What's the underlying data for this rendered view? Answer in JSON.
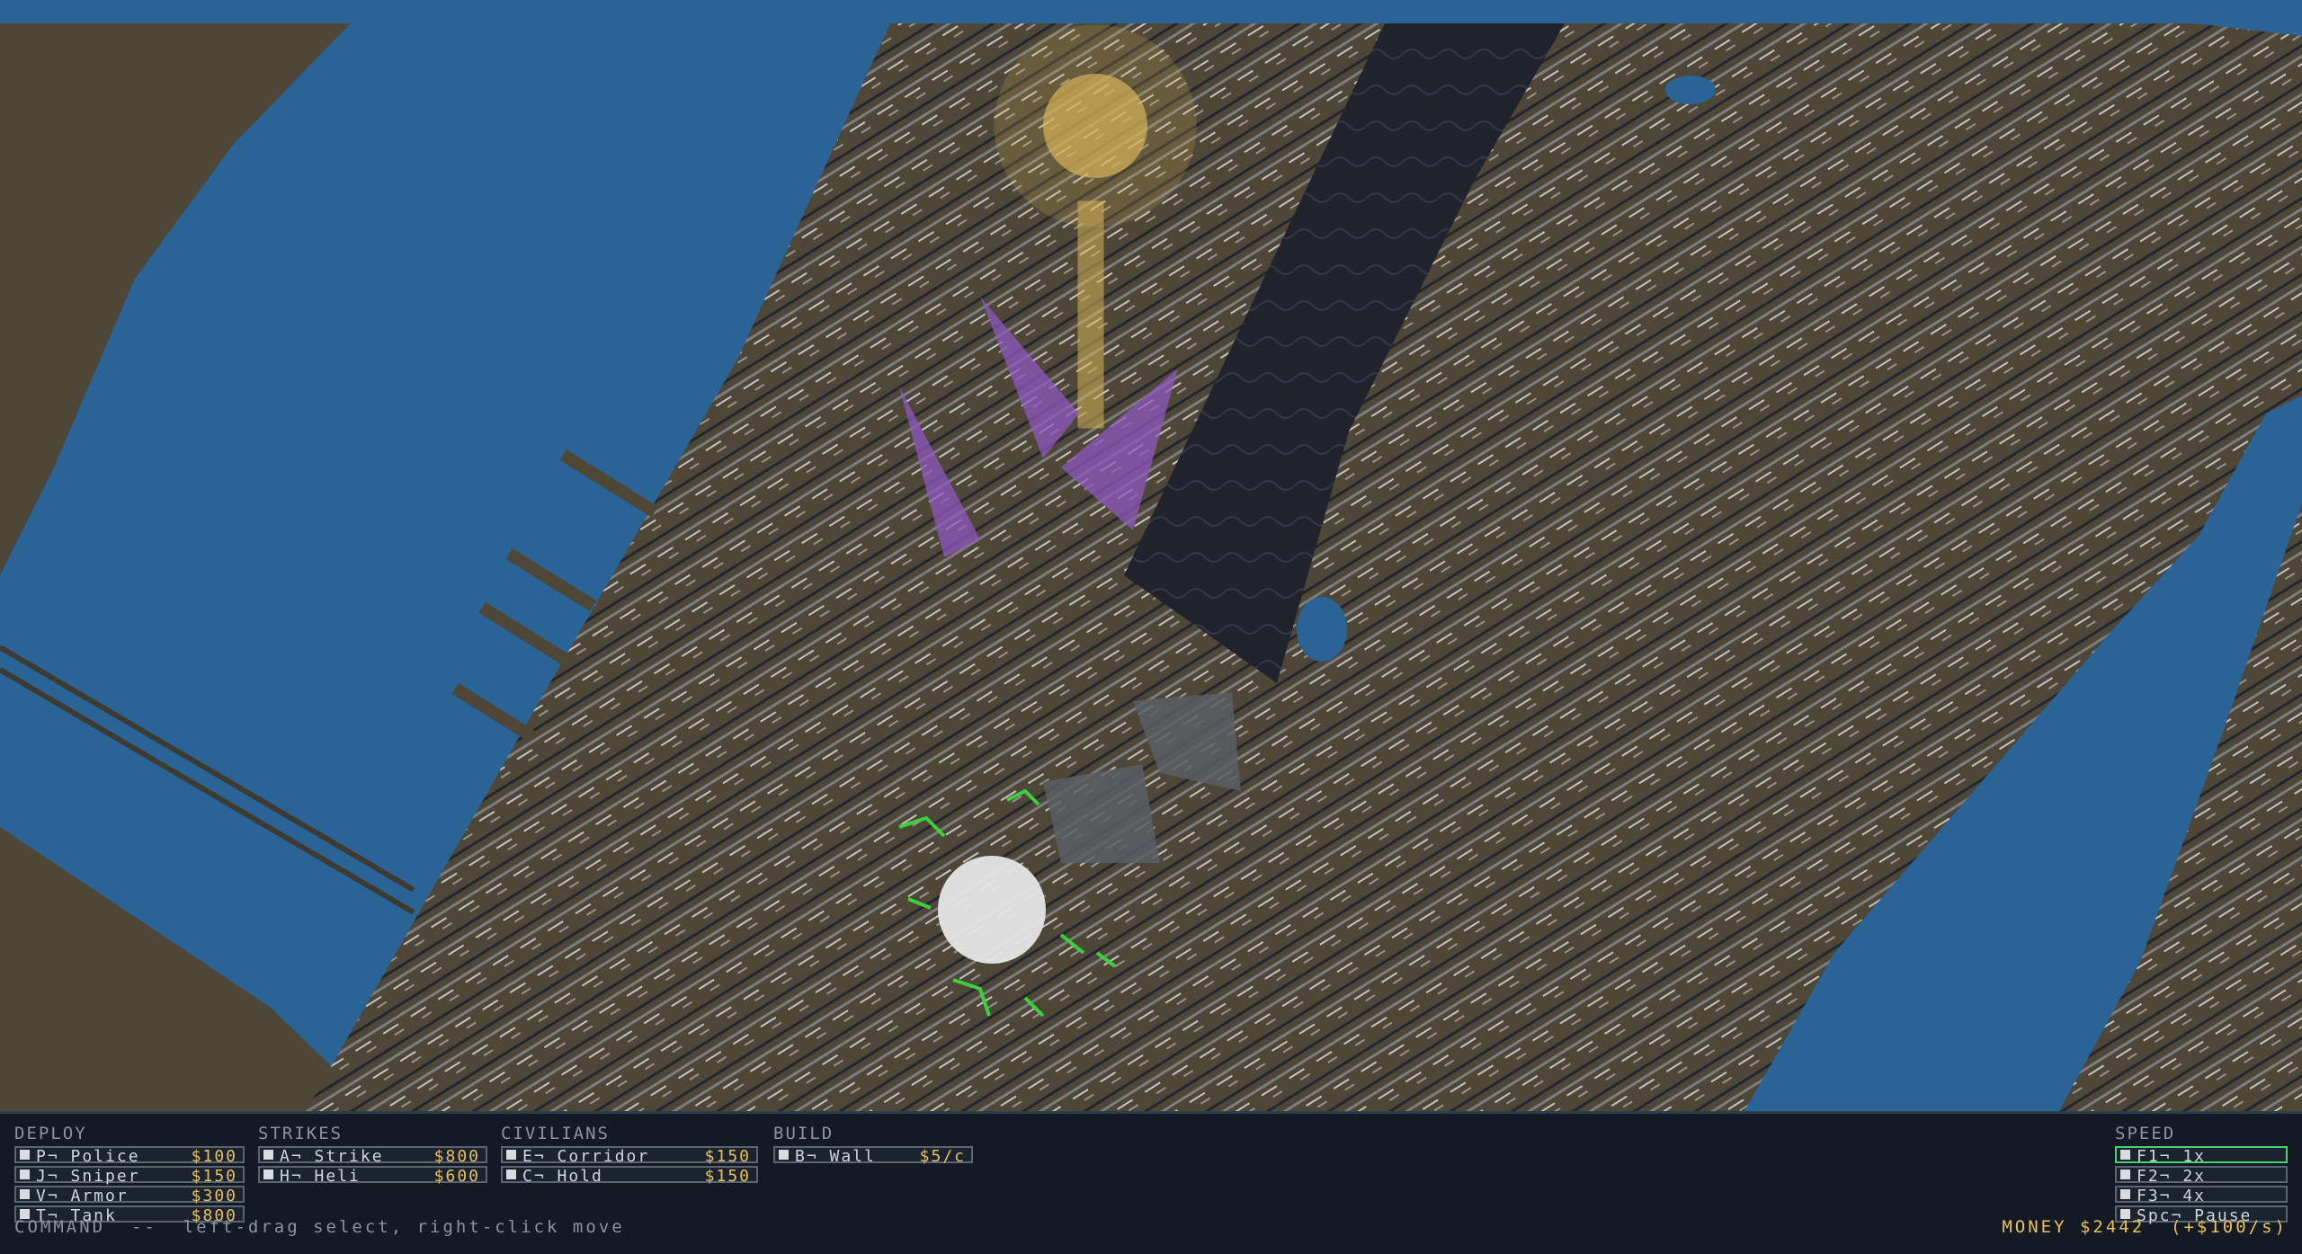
{
  "hud": {
    "deploy": {
      "title": "DEPLOY",
      "items": [
        {
          "label": "P¬ Police",
          "cost": "$100"
        },
        {
          "label": "J¬ Sniper",
          "cost": "$150"
        },
        {
          "label": "V¬ Armor",
          "cost": "$300"
        },
        {
          "label": "T¬ Tank",
          "cost": "$800"
        }
      ]
    },
    "strikes": {
      "title": "STRIKES",
      "items": [
        {
          "label": "A¬ Strike",
          "cost": "$800"
        },
        {
          "label": "H¬ Heli",
          "cost": "$600"
        }
      ]
    },
    "civilians": {
      "title": "CIVILIANS",
      "items": [
        {
          "label": "E¬ Corridor",
          "cost": "$150"
        },
        {
          "label": "C¬ Hold",
          "cost": "$150"
        }
      ]
    },
    "build": {
      "title": "BUILD",
      "items": [
        {
          "label": "B¬ Wall",
          "cost": "$5/c"
        }
      ]
    },
    "speed": {
      "title": "SPEED",
      "items": [
        {
          "label": "F1¬ 1x",
          "active": true
        },
        {
          "label": "F2¬ 2x",
          "active": false
        },
        {
          "label": "F3¬ 4x",
          "active": false
        },
        {
          "label": "Spc¬ Pause",
          "active": false
        }
      ]
    },
    "status": "COMMAND  --  left-drag select, right-click move",
    "money": "MONEY $2442  (+$100/s)"
  },
  "colors": {
    "water": "#2a6496",
    "land": "#4e4636",
    "park": "#20232c",
    "hud_bg": "#141a24",
    "accent_money": "#e8c15a",
    "active_speed": "#46d46a",
    "purple_zone": "#8e58c0",
    "gold_zone": "#d7b458",
    "green_units": "#3ecf3e"
  }
}
